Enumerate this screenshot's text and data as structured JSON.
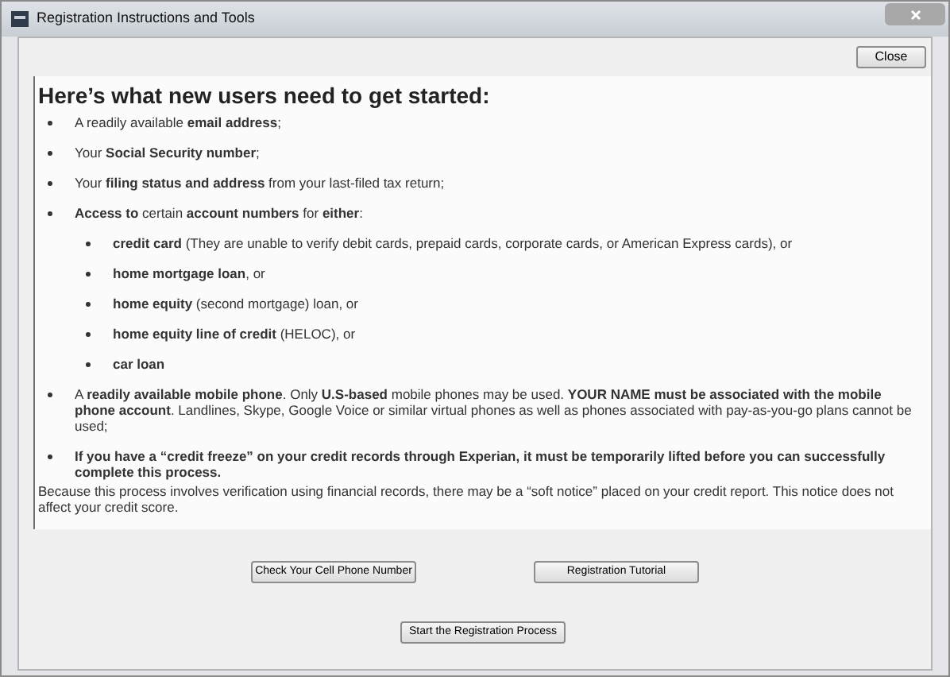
{
  "window": {
    "title": "Registration Instructions and Tools"
  },
  "close_button": "Close",
  "heading": "Here’s what new users need to get started:",
  "items": [
    {
      "text": "A readily available **email address**;"
    },
    {
      "text": "Your **Social Security number**;"
    },
    {
      "text": "Your **filing status and address** from your last-filed tax return;"
    },
    {
      "text": "**Access to** certain **account numbers** for **either**:",
      "children": [
        {
          "text": "**credit card** (They are unable to verify debit cards, prepaid cards, corporate cards, or American Express cards), or"
        },
        {
          "text": "**home mortgage loan**, or"
        },
        {
          "text": "**home equity** (second mortgage) loan, or"
        },
        {
          "text": "**home equity line of credit** (HELOC), or"
        },
        {
          "text": "**car loan**"
        }
      ]
    },
    {
      "text": "A **readily available mobile phone**. Only **U.S-based** mobile phones may be used. **YOUR NAME must be associated with the mobile phone account**. Landlines, Skype, Google Voice or similar virtual phones as well as phones associated with pay-as-you-go plans cannot be used;"
    },
    {
      "text": "**If you have a “credit freeze” on your credit records through Experian, it must be temporarily lifted before you can successfully complete this process.**"
    }
  ],
  "note": "Because this process involves verification using financial records, there may be a “soft notice” placed on your credit report. This notice does not affect your credit score.",
  "buttons": [
    "Check Your Cell Phone Number",
    "Registration Tutorial",
    "Start the Registration Process"
  ]
}
